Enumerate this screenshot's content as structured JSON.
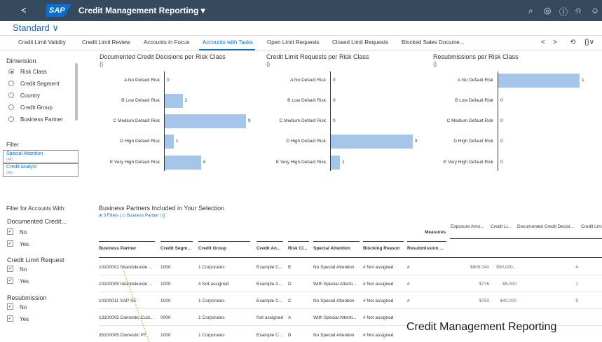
{
  "shell": {
    "back_label": "<",
    "logo_text": "SAP",
    "app_title": "Credit Management Reporting ▾",
    "icons": [
      "search-icon",
      "settings-icon",
      "help-icon",
      "bell-icon",
      "user-icon"
    ]
  },
  "variant": {
    "label": "Standard ∨"
  },
  "tabs": [
    {
      "label": "Credit Limit Validity"
    },
    {
      "label": "Credit Limit Review"
    },
    {
      "label": "Accounts in Focus"
    },
    {
      "label": "Accounts with Tasks"
    },
    {
      "label": "Open Limit Requests"
    },
    {
      "label": "Closed Limit Requests"
    },
    {
      "label": "Blocked Sales Docume..."
    }
  ],
  "tab_nav": {
    "prev": "<",
    "next": ">",
    "history": "⟲",
    "code": "{}∨"
  },
  "dimension": {
    "heading": "Dimension",
    "options": [
      {
        "label": "Risk Class",
        "selected": true
      },
      {
        "label": "Credit Segment",
        "selected": false
      },
      {
        "label": "Country",
        "selected": false
      },
      {
        "label": "Credit Group",
        "selected": false
      },
      {
        "label": "Business Partner",
        "selected": false
      }
    ]
  },
  "filter": {
    "heading": "Filter",
    "boxes": [
      {
        "label": "Special Attention",
        "sub": "(All)"
      },
      {
        "label": "Credit Analyst",
        "sub": "(All)"
      }
    ]
  },
  "accounts_filter": {
    "heading": "Filter for Accounts With:",
    "groups": [
      {
        "title": "Documented Credit...",
        "items": [
          {
            "label": "No",
            "check": "✓"
          },
          {
            "label": "Yes",
            "check": "✓"
          }
        ]
      },
      {
        "title": "Credit Limit Request",
        "items": [
          {
            "label": "No",
            "check": "✓"
          },
          {
            "label": "Yes",
            "check": "✓"
          }
        ]
      },
      {
        "title": "Resubmission",
        "items": [
          {
            "label": "No",
            "check": "✓"
          },
          {
            "label": "Yes",
            "check": "✓"
          }
        ]
      }
    ]
  },
  "charts_subtitle": "{}",
  "chart_data": [
    {
      "type": "bar",
      "title": "Documented Credit Decisions per Risk Class",
      "categories": [
        "A No Default Risk",
        "B Low Default Risk",
        "C Medium Default Risk",
        "D High Default Risk",
        "E Very High Default Risk"
      ],
      "values": [
        0,
        2,
        9,
        1,
        4
      ],
      "xlim": [
        0,
        9
      ]
    },
    {
      "type": "bar",
      "title": "Credit Limit Requests per Risk Class",
      "categories": [
        "A No Default Risk",
        "B Low Default Risk",
        "C Medium Default Risk",
        "D High Default Risk",
        "E Very High Default Risk"
      ],
      "values": [
        0,
        0,
        0,
        9,
        1
      ],
      "xlim": [
        0,
        9
      ]
    },
    {
      "type": "bar",
      "title": "Resubmissions per Risk Class",
      "categories": [
        "A No Default Risk",
        "B Low Default Risk",
        "C Medium Default Risk",
        "D High Default Risk",
        "E Very High Default Risk"
      ],
      "values": [
        1,
        0,
        0,
        0,
        0
      ],
      "xlim": [
        0,
        1
      ]
    }
  ],
  "table": {
    "title": "Business Partners Included in Your Selection",
    "filters": "⊕  3 Filters  | ⚠ Business Partner  |  {}",
    "measures_label": "Measures",
    "measure_headers": [
      "Exposure Amo...",
      "Credit Li...",
      "Documented Credit Decisi...",
      "Credit Lim"
    ],
    "columns": [
      "Business Partner",
      "Credit Segm...",
      "Credit Group",
      "Credit An...",
      "Risk Cl...",
      "Special Attention",
      "Blocking Reason",
      "Resubmission ..."
    ],
    "rows": [
      {
        "bp": "10100001 Inlandskunde ...",
        "seg": "1000",
        "grp": "1 Corporates",
        "an": "Example C...",
        "rc": "E",
        "sa": "No Special Attention",
        "br": "# Not assigned",
        "rs": "#",
        "exp": "$806,040",
        "cl": "$50,000...",
        "dcd": "4"
      },
      {
        "bp": "10100005 Inlandskunde ...",
        "seg": "1000",
        "grp": "# Not assigned",
        "an": "Example A...",
        "rc": "D",
        "sa": "With Special Attenti...",
        "br": "# Not assigned",
        "rs": "#",
        "exp": "$776",
        "cl": "$5,000",
        "dcd": "1"
      },
      {
        "bp": "10100011 SAP SE",
        "seg": "1000",
        "grp": "1 Corporates",
        "an": "Example C...",
        "rc": "C",
        "sa": "No Special Attention",
        "br": "# Not assigned",
        "rs": "#",
        "exp": "$750",
        "cl": "$40,000",
        "dcd": "9"
      },
      {
        "bp": "13100005 Domestic Cust...",
        "seg": "0000",
        "grp": "1 Corporates",
        "an": "Not assigned",
        "rc": "A",
        "sa": "With Special Attenti...",
        "br": "# Not assigned",
        "rs": "",
        "exp": "",
        "cl": "",
        "dcd": ""
      },
      {
        "bp": "35100005 Domestic PT",
        "seg": "1000",
        "grp": "1 Corporates",
        "an": "Example C...",
        "rc": "B",
        "sa": "No Special Attention",
        "br": "# Not assigned",
        "rs": "",
        "exp": "",
        "cl": "",
        "dcd": ""
      }
    ]
  },
  "caption": "Credit Management Reporting"
}
